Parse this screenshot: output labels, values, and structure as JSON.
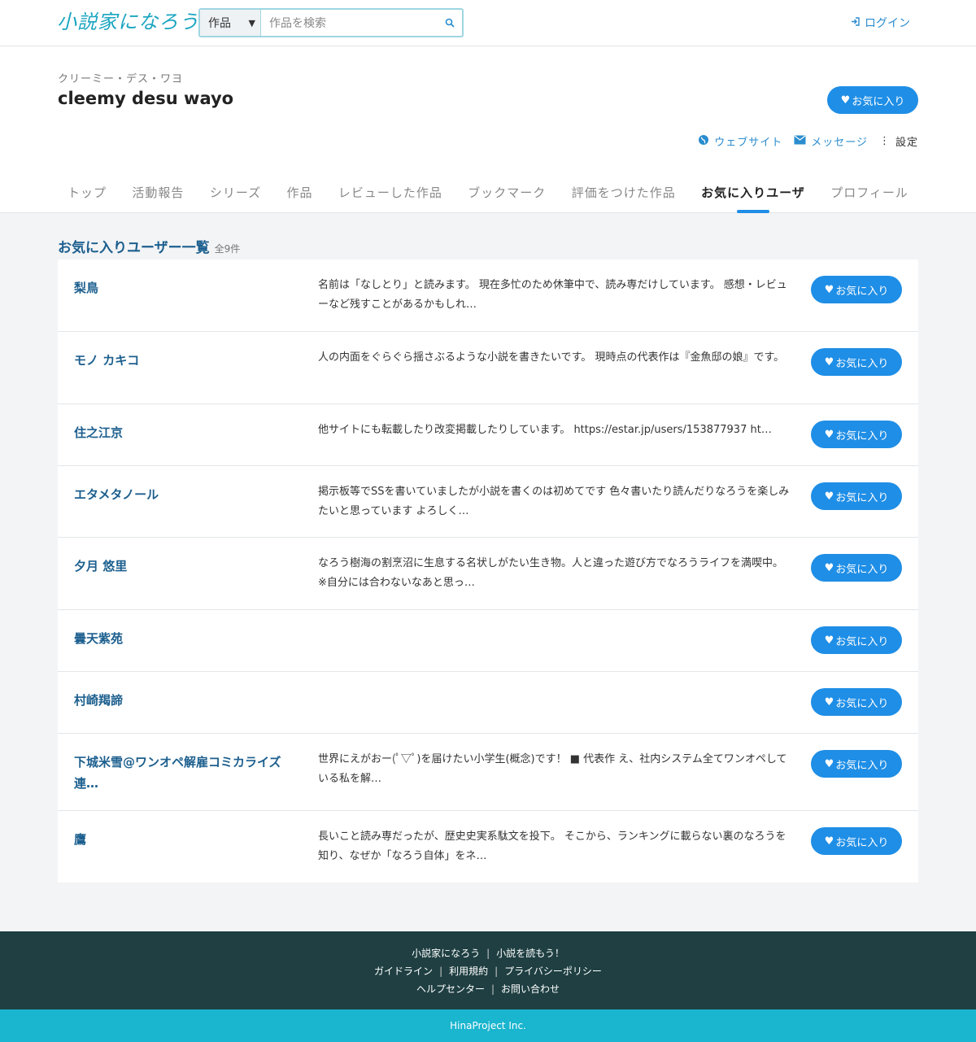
{
  "header": {
    "logo": "小説家になろう",
    "search_type": "作品",
    "search_placeholder": "作品を検索",
    "login": "ログイン"
  },
  "profile": {
    "kana": "クリーミー・デス・ワヨ",
    "name": "cleemy desu wayo",
    "fav_button": "お気に入り",
    "links": {
      "website": "ウェブサイト",
      "message": "メッセージ",
      "settings": "設定"
    }
  },
  "tabs": [
    {
      "label": "トップ"
    },
    {
      "label": "活動報告"
    },
    {
      "label": "シリーズ"
    },
    {
      "label": "作品"
    },
    {
      "label": "レビューした作品"
    },
    {
      "label": "ブックマーク"
    },
    {
      "label": "評価をつけた作品"
    },
    {
      "label": "お気に入りユーザ"
    },
    {
      "label": "プロフィール"
    }
  ],
  "list": {
    "title": "お気に入りユーザー一覧",
    "count": "全9件",
    "fav_label": "お気に入り",
    "users": [
      {
        "name": "梨鳥",
        "desc": "名前は「なしとり」と読みます。 現在多忙のため休筆中で、読み専だけしています。 感想・レビューなど残すことがあるかもしれ…"
      },
      {
        "name": "モノ カキコ",
        "desc": "人の内面をぐらぐら揺さぶるような小説を書きたいです。 現時点の代表作は『金魚邸の娘』です。"
      },
      {
        "name": "住之江京",
        "desc": "他サイトにも転載したり改変掲載したりしています。 https://estar.jp/users/153877937 ht…"
      },
      {
        "name": "エタメタノール",
        "desc": "掲示板等でSSを書いていましたが小説を書くのは初めてです 色々書いたり読んだりなろうを楽しみたいと思っています よろしく…"
      },
      {
        "name": "夕月 悠里",
        "desc": "なろう樹海の割烹沼に生息する名状しがたい生き物。人と違った遊び方でなろうライフを満喫中。 ※自分には合わないなあと思っ…"
      },
      {
        "name": "曇天紫苑",
        "desc": ""
      },
      {
        "name": "村崎羯諦",
        "desc": ""
      },
      {
        "name": "下城米雪@ワンオペ解雇コミカライズ連…",
        "desc": "世界にえがおー(ﾟ▽ﾟ)を届けたい小学生(概念)です！ ■ 代表作 え、社内システム全てワンオペしている私を解…"
      },
      {
        "name": "鷹",
        "desc": "長いこと読み専だったが、歴史史実系駄文を投下。 そこから、ランキングに載らない裏のなろうを知り、なぜか「なろう自体」をネ…"
      }
    ]
  },
  "footer": {
    "line1": [
      "小説家になろう",
      "小説を読もう！"
    ],
    "line2": [
      "ガイドライン",
      "利用規約",
      "プライバシーポリシー"
    ],
    "line3": [
      "ヘルプセンター",
      "お問い合わせ"
    ],
    "copyright": "HinaProject Inc."
  }
}
